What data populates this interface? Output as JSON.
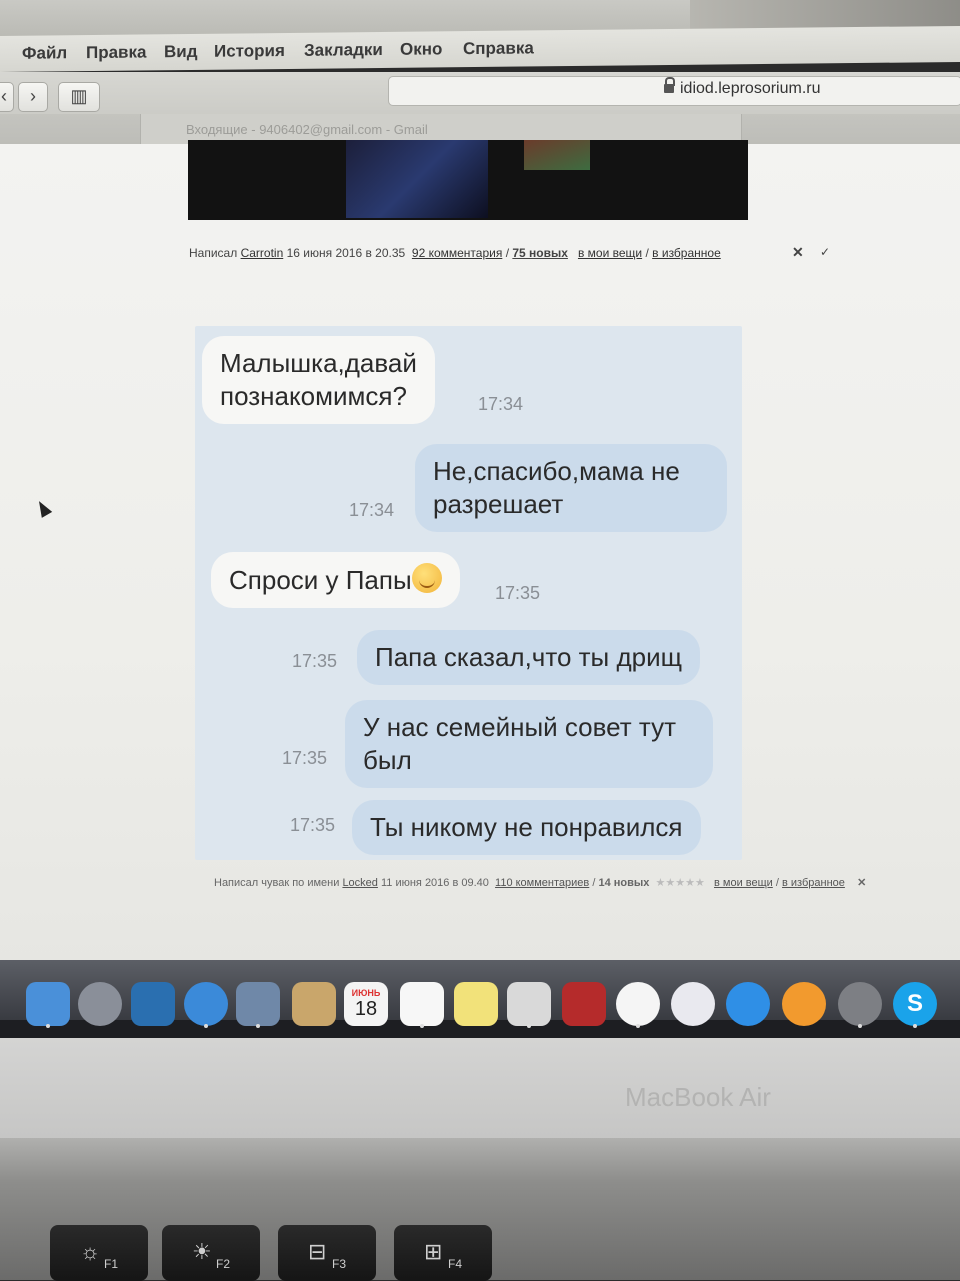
{
  "menubar": {
    "items": [
      "Файл",
      "Правка",
      "Вид",
      "История",
      "Закладки",
      "Окно",
      "Справка"
    ]
  },
  "browser": {
    "url": "idiod.leprosorium.ru",
    "tab_title": "Входящие - 9406402@gmail.com - Gmail",
    "back_glyph": "‹",
    "forward_glyph": "›",
    "sidebar_glyph": "▥"
  },
  "post1": {
    "prefix": "Написал",
    "author": "Carrotin",
    "date": "16 июня 2016 в 20.35",
    "comments": "92 комментария",
    "sep": "/",
    "new": "75 новых",
    "my_things": "в мои вещи",
    "favorites": "в избранное",
    "close_glyph": "✕",
    "check_glyph": "✓"
  },
  "chat": {
    "messages": [
      {
        "side": "in",
        "lines": [
          "Малышка,давай",
          "познакомимся?"
        ],
        "time": "17:34"
      },
      {
        "side": "out",
        "lines": [
          "Не,спасибо,мама не",
          "разрешает"
        ],
        "time": "17:34"
      },
      {
        "side": "in",
        "lines": [
          "Спроси у Папы"
        ],
        "time": "17:35"
      },
      {
        "side": "out",
        "lines": [
          "Папа сказал,что ты дрищ"
        ],
        "time": "17:35"
      },
      {
        "side": "out",
        "lines": [
          "У нас семейный совет тут",
          "был"
        ],
        "time": "17:35"
      },
      {
        "side": "out",
        "lines": [
          "Ты никому не понравился"
        ],
        "time": "17:35"
      }
    ]
  },
  "post2": {
    "prefix": "Написал чувак по имени",
    "author": "Locked",
    "date": "11 июня 2016 в 09.40",
    "comments": "110 комментариев",
    "sep": "/",
    "new": "14 новых",
    "stars": "★★★★★",
    "my_things": "в мои вещи",
    "favorites": "в избранное",
    "close_glyph": "✕"
  },
  "dock": {
    "calendar_month": "ИЮНЬ",
    "calendar_day": "18",
    "skype_letter": "S",
    "colors": {
      "finder": "#4a90d9",
      "launchpad": "#8a8f99",
      "mission": "#2a6fb0",
      "safari": "#3b8ad9",
      "preview": "#6f88a8",
      "contacts": "#c9a66b",
      "calendar": "#f4f4f4",
      "reminders": "#f7f7f7",
      "notes": "#f2e27a",
      "preview2": "#d9d9d9",
      "photobooth": "#b52b2b",
      "photos": "#f5f5f5",
      "itunes": "#e9e9ef",
      "appstore": "#2f8fe6",
      "ibooks": "#f29a2e",
      "prefs": "#7d7f84",
      "skype": "#1aa3ea"
    }
  },
  "device": {
    "brand": "MacBook Air",
    "keys": [
      {
        "symbol": "☼",
        "label": "F1"
      },
      {
        "symbol": "☀",
        "label": "F2"
      },
      {
        "symbol": "⊟",
        "label": "F3"
      },
      {
        "symbol": "⊞",
        "label": "F4"
      }
    ]
  }
}
